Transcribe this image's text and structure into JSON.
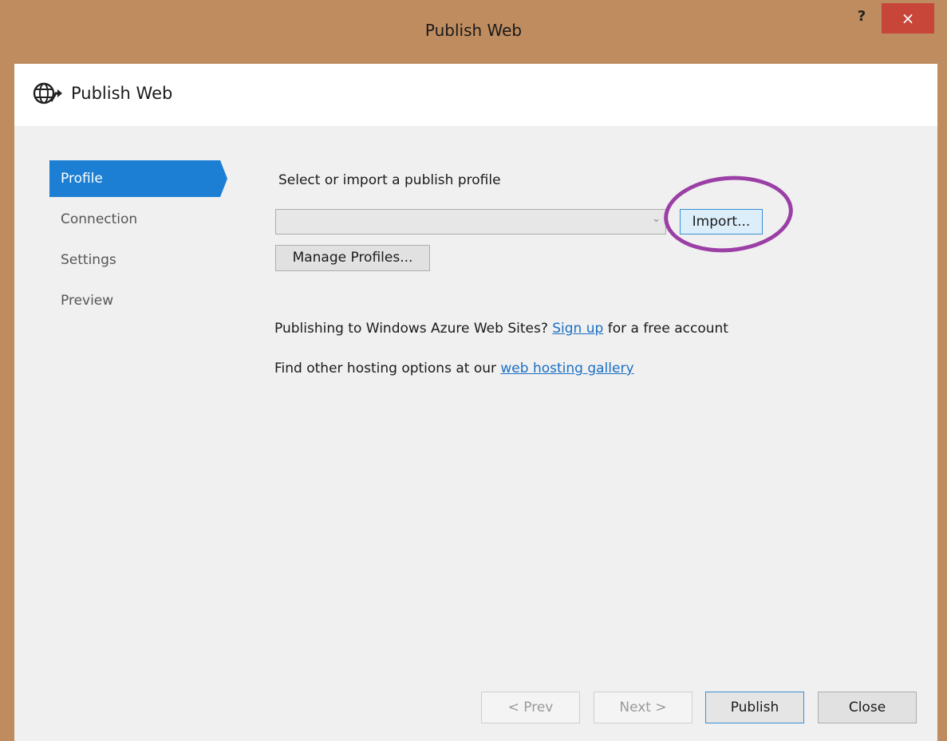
{
  "window": {
    "title": "Publish Web",
    "help_label": "?",
    "close_label": "×"
  },
  "header": {
    "title": "Publish Web",
    "icon": "globe-publish-icon"
  },
  "nav": {
    "items": [
      {
        "label": "Profile",
        "active": true
      },
      {
        "label": "Connection",
        "active": false
      },
      {
        "label": "Settings",
        "active": false
      },
      {
        "label": "Preview",
        "active": false
      }
    ]
  },
  "main": {
    "heading": "Select or import a publish profile",
    "profile_select": {
      "value": ""
    },
    "import_label": "Import...",
    "manage_label": "Manage Profiles...",
    "azure_prefix": "Publishing to Windows Azure Web Sites? ",
    "azure_link": "Sign up",
    "azure_suffix": " for a free account",
    "hosting_prefix": "Find other hosting options at our ",
    "hosting_link": "web hosting gallery"
  },
  "footer": {
    "prev_label": "< Prev",
    "next_label": "Next >",
    "publish_label": "Publish",
    "close_label": "Close"
  },
  "colors": {
    "frame": "#be8c5f",
    "accent": "#1c7fd3",
    "annotation": "#9b3fa6",
    "close_red": "#c8453a"
  }
}
